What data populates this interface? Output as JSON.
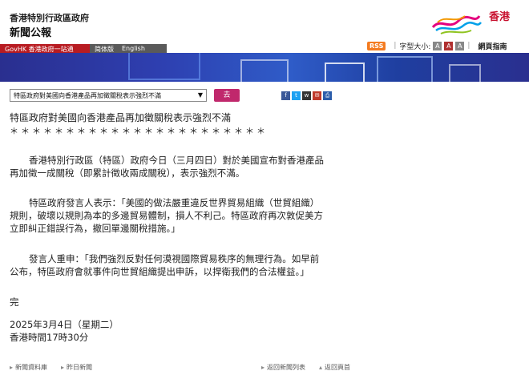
{
  "header": {
    "gov_name": "香港特別行政區政府",
    "news_title": "新聞公報",
    "logo_text": "香港",
    "rss_label": "RSS",
    "font_size_label": "字型大小:",
    "font_sizes": [
      "A",
      "A",
      "A"
    ],
    "sitemap_label": "網頁指南"
  },
  "nav": {
    "gov_portal": "GovHK 香港政府一站通",
    "lang_simplified": "简体版",
    "lang_english": "English"
  },
  "selector": {
    "selected_value": "特區政府對美國向香港產品再加徵關稅表示強烈不滿",
    "go_label": "去"
  },
  "share_icons": [
    "facebook-icon",
    "twitter-icon",
    "weibo-icon",
    "email-icon",
    "print-icon"
  ],
  "article": {
    "title": "特區政府對美國向香港產品再加徵關稅表示強烈不滿",
    "stars": "＊＊＊＊＊＊＊＊＊＊＊＊＊＊＊＊＊＊＊＊＊＊＊",
    "para1_line1": "香港特別行政區（特區）政府今日（三月四日）對於美國宣布對香港產品",
    "para1_line2": "再加徵一成關稅（即累計徵收兩成關稅），表示強烈不滿。",
    "para2_line1": "特區政府發言人表示：「美國的做法嚴重違反世界貿易組織（世貿組織）",
    "para2_line2": "規則，破壞以規則為本的多邊貿易體制，損人不利己。特區政府再次敦促美方",
    "para2_line3": "立即糾正錯誤行為，撤回單邊關稅措施。」",
    "para3_line1": "發言人重申：「我們強烈反對任何漠視國際貿易秩序的無理行為。如早前",
    "para3_line2": "公布，特區政府會就事件向世貿組織提出申訴，以捍衛我們的合法權益。」",
    "end": "完",
    "date": "2025年3月4日（星期二）",
    "time": "香港時間17時30分"
  },
  "footer": {
    "archive": "新聞資料庫",
    "yesterday": "昨日新聞",
    "back_list": "返回新聞列表",
    "back_top": "返回頁首"
  },
  "colors": {
    "accent_red": "#b81c22",
    "go_button": "#c0286c",
    "banner_blue": "#2e3fb0"
  }
}
